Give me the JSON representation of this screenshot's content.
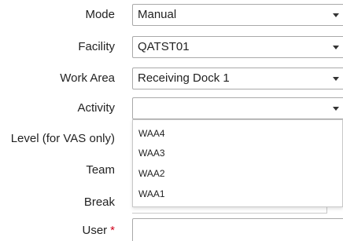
{
  "form": {
    "mode": {
      "label": "Mode",
      "value": "Manual"
    },
    "facility": {
      "label": "Facility",
      "value": "QATST01"
    },
    "work_area": {
      "label": "Work Area",
      "value": "Receiving Dock 1"
    },
    "activity": {
      "label": "Activity",
      "value": "",
      "options": [
        "WAA4",
        "WAA3",
        "WAA2",
        "WAA1"
      ]
    },
    "level": {
      "label": "Level (for VAS only)"
    },
    "team": {
      "label": "Team"
    },
    "break": {
      "label": "Break"
    },
    "user": {
      "label": "User",
      "required_marker": "*",
      "value": ""
    }
  },
  "colors": {
    "required": "#d0021b",
    "border": "#a9a9a9"
  }
}
